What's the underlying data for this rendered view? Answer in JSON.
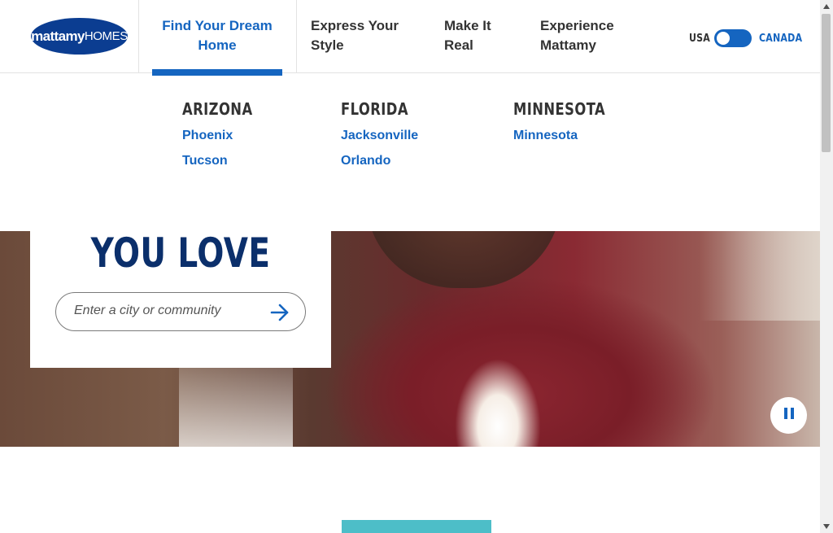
{
  "header": {
    "logo": {
      "bold": "mattamy",
      "thin": "HOMES"
    },
    "nav": [
      {
        "line1": "Find Your Dream",
        "line2": "Home"
      },
      {
        "line1": "Express Your",
        "line2": "Style"
      },
      {
        "line1": "Make It",
        "line2": "Real"
      },
      {
        "line1": "Experience",
        "line2": "Mattamy"
      }
    ],
    "region_toggle": {
      "left_label": "USA",
      "right_label": "CANADA",
      "selected": "USA"
    }
  },
  "dropdown": {
    "columns": [
      {
        "title": "ARIZONA",
        "links": [
          "Phoenix",
          "Tucson"
        ]
      },
      {
        "title": "FLORIDA",
        "links": [
          "Jacksonville",
          "Orlando"
        ]
      },
      {
        "title": "MINNESOTA",
        "links": [
          "Minnesota"
        ]
      }
    ]
  },
  "hero": {
    "title": "YOU LOVE",
    "search": {
      "placeholder": "Enter a city or community",
      "value": ""
    },
    "pause_icon": "pause-icon"
  },
  "colors": {
    "brand_blue": "#1565c0",
    "navy": "#0b2f6b",
    "logo_blue": "#0b3d91",
    "teal": "#4dbec8"
  }
}
